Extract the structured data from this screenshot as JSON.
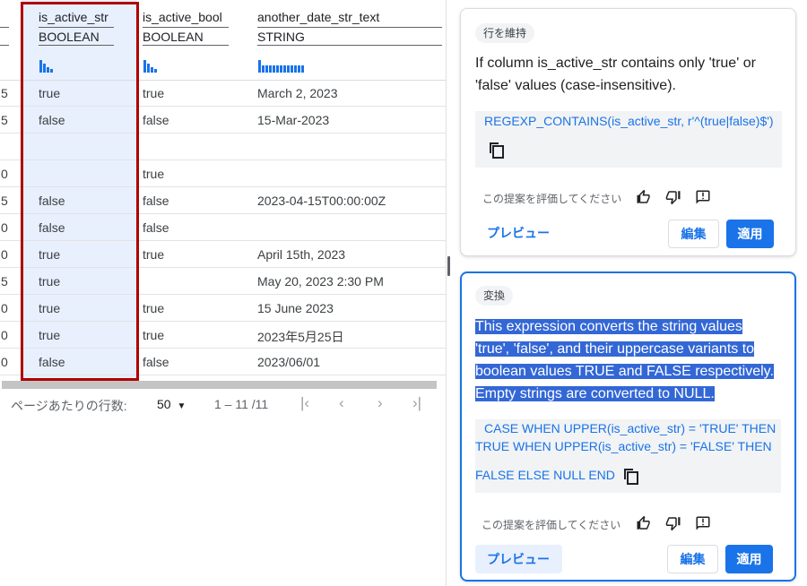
{
  "table": {
    "columns": [
      {
        "name": "is_active_str",
        "type": "BOOLEAN"
      },
      {
        "name": "is_active_bool",
        "type": "BOOLEAN"
      },
      {
        "name": "another_date_str_text",
        "type": "STRING"
      }
    ],
    "rows": [
      {
        "prev": "5",
        "str": "true",
        "bool": "true",
        "date": "March 2, 2023"
      },
      {
        "prev": "5",
        "str": "false",
        "bool": "false",
        "date": "15-Mar-2023"
      },
      {
        "prev": "",
        "str": "",
        "bool": "",
        "date": ""
      },
      {
        "prev": "0",
        "str": "",
        "bool": "true",
        "date": ""
      },
      {
        "prev": "5",
        "str": "false",
        "bool": "false",
        "date": "2023-04-15T00:00:00Z"
      },
      {
        "prev": "0",
        "str": "false",
        "bool": "false",
        "date": ""
      },
      {
        "prev": "0",
        "str": "true",
        "bool": "true",
        "date": "April 15th, 2023"
      },
      {
        "prev": "5",
        "str": "true",
        "bool": "",
        "date": "May 20, 2023 2:30 PM"
      },
      {
        "prev": "0",
        "str": "true",
        "bool": "true",
        "date": "15 June 2023"
      },
      {
        "prev": "0",
        "str": "true",
        "bool": "true",
        "date": "2023年5月25日"
      },
      {
        "prev": "0",
        "str": "false",
        "bool": "false",
        "date": "2023/06/01"
      }
    ],
    "pagination": {
      "rows_per_page_label": "ページあたりの行数:",
      "rows_per_page_value": "50",
      "range": "1 – 11 /11"
    }
  },
  "cards": [
    {
      "chip": "行を維持",
      "description": "If column is_active_str contains only 'true' or 'false' values (case-insensitive).",
      "code_line1": "REGEXP_CONTAINS(is_active_str, r'^(true|false)$')",
      "rate_label": "この提案を評価してください",
      "preview_label": "プレビュー",
      "edit_label": "編集",
      "apply_label": "適用"
    },
    {
      "chip": "変換",
      "description_lines": [
        "This expression converts the string values",
        "'true', 'false', and their uppercase variants to",
        "boolean values TRUE and FALSE respectively.",
        "Empty strings are converted to NULL."
      ],
      "code_line1": "CASE WHEN UPPER(is_active_str) = 'TRUE' THEN",
      "code_line2": "TRUE WHEN UPPER(is_active_str) = 'FALSE' THEN",
      "code_line3": "FALSE ELSE NULL END",
      "rate_label": "この提案を評価してください",
      "preview_label": "プレビュー",
      "edit_label": "編集",
      "apply_label": "適用"
    }
  ],
  "colors": {
    "accent": "#1a73e8",
    "highlight_column": "#e8f0fe",
    "annotation_box": "#b00000",
    "selection": "#3367d6"
  },
  "icons": [
    "copy-icon",
    "thumbs-up-icon",
    "thumbs-down-icon",
    "feedback-icon",
    "dropdown-arrow-icon",
    "first-page-icon",
    "prev-page-icon",
    "next-page-icon",
    "last-page-icon"
  ]
}
